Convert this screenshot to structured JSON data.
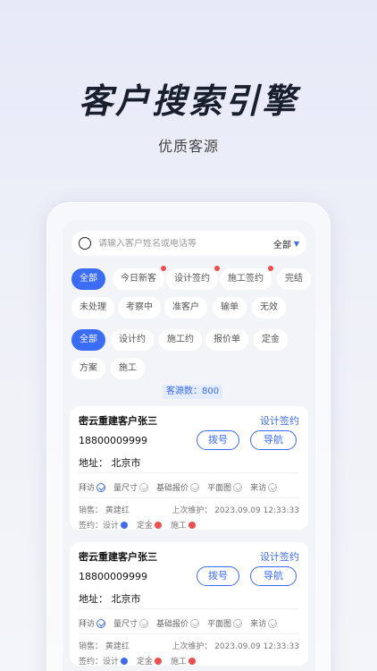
{
  "hero": {
    "title": "客户搜索引擎",
    "subtitle": "优质客源"
  },
  "search": {
    "placeholder": "请输入客户姓名或电话等",
    "filter_label": "全部"
  },
  "status_tabs": [
    "全部",
    "今日新客",
    "设计签约",
    "施工签约",
    "完结",
    "未处理",
    "考察中",
    "准客户",
    "输单",
    "无效"
  ],
  "stage_tabs": [
    "全部",
    "设计约",
    "施工约",
    "报价单",
    "定金",
    "方案",
    "施工"
  ],
  "count_label": "客源数：800",
  "cards": [
    {
      "name": "密云重建客户张三",
      "status": "设计签约",
      "phone": "18800009999",
      "address": "地址： 北京市",
      "call_label": "拨号",
      "nav_label": "导航",
      "steps": [
        "拜访",
        "量尺寸",
        "基础报价",
        "平面图",
        "来访"
      ],
      "sales": "销售： 黄建红",
      "last_maint": "上次维护： 2023.09.09 12:33:33",
      "sign_label": "签约：",
      "sign_items": [
        "设计",
        "定金",
        "施工"
      ]
    },
    {
      "name": "密云重建客户张三",
      "status": "设计签约",
      "phone": "18800009999",
      "address": "地址： 北京市",
      "call_label": "拨号",
      "nav_label": "导航",
      "steps": [
        "拜访",
        "量尺寸",
        "基础报价",
        "平面图",
        "来访"
      ],
      "sales": "销售： 黄建红",
      "last_maint": "上次维护： 2023.09.09 12:33:33",
      "sign_label": "签约：",
      "sign_items": [
        "设计",
        "定金",
        "施工"
      ]
    }
  ],
  "colors": {
    "accent": "#3b6cf6",
    "alert": "#f04d4d"
  }
}
